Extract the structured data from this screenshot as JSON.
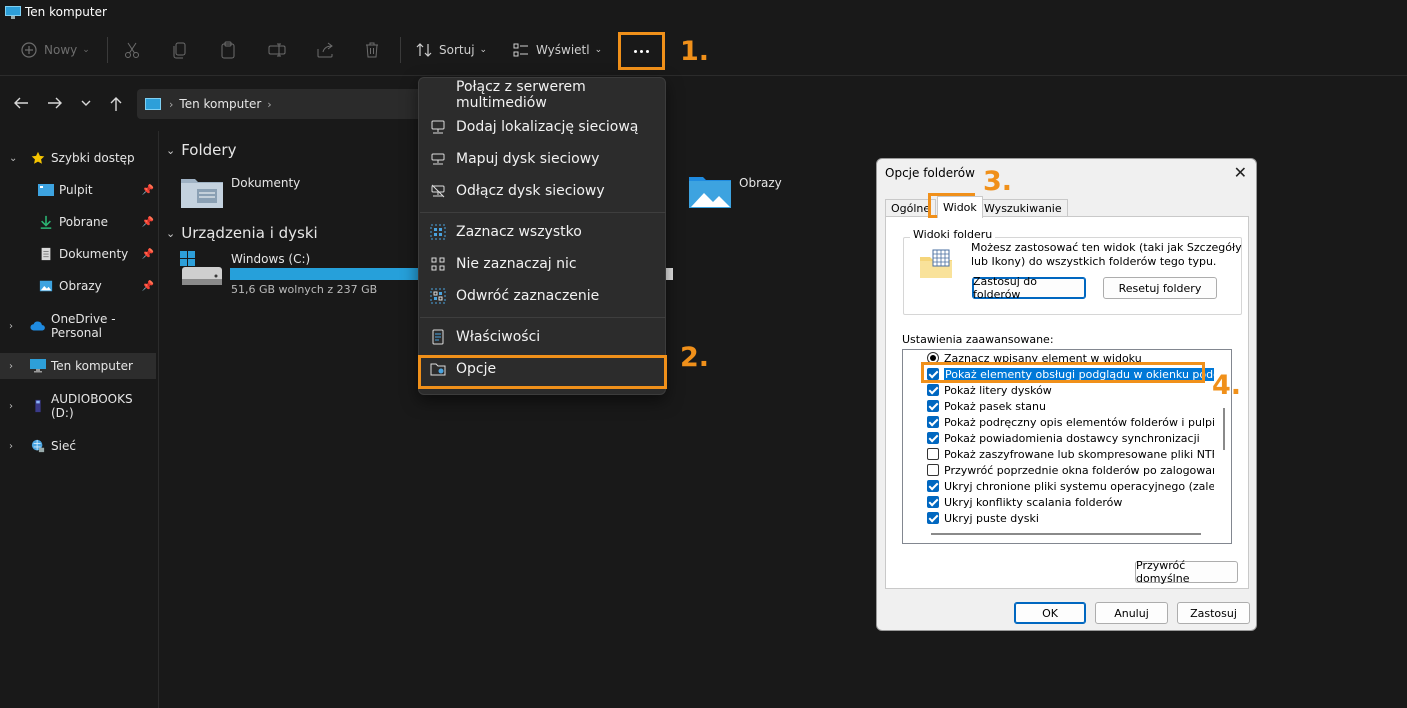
{
  "window": {
    "title": "Ten komputer"
  },
  "toolbar": {
    "new_label": "Nowy",
    "sort_label": "Sortuj",
    "view_label": "Wyświetl",
    "step1": "1."
  },
  "nav": {
    "address_label": "Ten komputer"
  },
  "sidebar": {
    "items": [
      {
        "label": "Szybki dostęp"
      },
      {
        "label": "Pulpit"
      },
      {
        "label": "Pobrane"
      },
      {
        "label": "Dokumenty"
      },
      {
        "label": "Obrazy"
      },
      {
        "label": "OneDrive - Personal"
      },
      {
        "label": "Ten komputer"
      },
      {
        "label": "AUDIOBOOKS (D:)"
      },
      {
        "label": "Sieć"
      }
    ]
  },
  "content": {
    "folders_header": "Foldery",
    "folders": [
      {
        "label": "Dokumenty"
      },
      {
        "label": "Obrazy"
      }
    ],
    "drives_header": "Urządzenia i dyski",
    "drive": {
      "name": "Windows (C:)",
      "free_text": "51,6 GB wolnych z 237 GB",
      "used_fraction": 0.78
    }
  },
  "menu": {
    "items": [
      {
        "label": "Połącz z serwerem multimediów"
      },
      {
        "label": "Dodaj lokalizację sieciową"
      },
      {
        "label": "Mapuj dysk sieciowy"
      },
      {
        "label": "Odłącz dysk sieciowy"
      },
      {
        "label": "Zaznacz wszystko"
      },
      {
        "label": "Nie zaznaczaj nic"
      },
      {
        "label": "Odwróć zaznaczenie"
      },
      {
        "label": "Właściwości"
      },
      {
        "label": "Opcje"
      }
    ],
    "step2": "2."
  },
  "dialog": {
    "title": "Opcje folderów",
    "close_glyph": "✕",
    "tabs": [
      {
        "label": "Ogólne"
      },
      {
        "label": "Widok"
      },
      {
        "label": "Wyszukiwanie"
      }
    ],
    "step3": "3.",
    "step4": "4.",
    "folder_views_legend": "Widoki folderu",
    "folder_views_desc": "Możesz zastosować ten widok (taki jak Szczegóły lub Ikony) do wszystkich folderów tego typu.",
    "apply_button": "Zastosuj do folderów",
    "reset_button": "Resetuj foldery",
    "advanced_label": "Ustawienia zaawansowane:",
    "advanced_items": [
      {
        "label": "Zaznacz wpisany element w widoku",
        "kind": "radio"
      },
      {
        "label": "Pokaż elementy obsługi podglądu w okienku podglądu",
        "kind": "check",
        "checked": true
      },
      {
        "label": "Pokaż litery dysków",
        "kind": "check",
        "checked": true
      },
      {
        "label": "Pokaż pasek stanu",
        "kind": "check",
        "checked": true
      },
      {
        "label": "Pokaż podręczny opis elementów folderów i pulpitu",
        "kind": "check",
        "checked": true
      },
      {
        "label": "Pokaż powiadomienia dostawcy synchronizacji",
        "kind": "check",
        "checked": true
      },
      {
        "label": "Pokaż zaszyfrowane lub skompresowane pliki NTFS w kolorze",
        "kind": "check",
        "checked": false
      },
      {
        "label": "Przywróć poprzednie okna folderów po zalogowaniu",
        "kind": "check",
        "checked": false
      },
      {
        "label": "Ukryj chronione pliki systemu operacyjnego (zalecane)",
        "kind": "check",
        "checked": true
      },
      {
        "label": "Ukryj konflikty scalania folderów",
        "kind": "check",
        "checked": true
      },
      {
        "label": "Ukryj puste dyski",
        "kind": "check",
        "checked": true
      }
    ],
    "restore_defaults_button": "Przywróć domyślne",
    "ok_button": "OK",
    "cancel_button": "Anuluj",
    "apply_bottom_button": "Zastosuj"
  }
}
